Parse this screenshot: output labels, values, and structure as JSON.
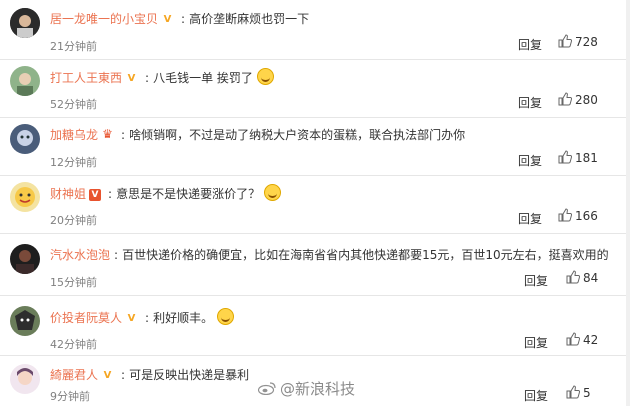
{
  "comments": [
    {
      "user": "居一龙唯一的小宝贝",
      "badge": "V",
      "text": "高价垄断麻烦也罚一下",
      "time": "21分钟前",
      "reply": "回复",
      "likes": "728"
    },
    {
      "user": "打工人王東西",
      "badge": "V",
      "text": "八毛钱一单 挨罚了",
      "time": "52分钟前",
      "reply": "回复",
      "likes": "280"
    },
    {
      "user": "加糖乌龙",
      "badge": "♛",
      "text": "啥倾销啊，不过是动了纳税大户资本的蛋糕，联合执法部门办你",
      "time": "12分钟前",
      "reply": "回复",
      "likes": "181"
    },
    {
      "user": "财神姐",
      "badge": "V",
      "text": "意思是不是快递要涨价了？",
      "time": "20分钟前",
      "reply": "回复",
      "likes": "166"
    },
    {
      "user": "汽水水泡泡",
      "badge": "",
      "text": "百世快递价格的确便宜，比如在海南省省内其他快递都要15元，百世10元左右，挺喜欢用的",
      "time": "15分钟前",
      "reply": "回复",
      "likes": "84"
    },
    {
      "user": "价投者阮莫人",
      "badge": "V",
      "text": "利好顺丰。",
      "time": "42分钟前",
      "reply": "回复",
      "likes": "42"
    },
    {
      "user": "綺麗君人",
      "badge": "V",
      "text": "可是反映出快递是暴利",
      "time": "9分钟前",
      "reply": "回复",
      "likes": "5"
    }
  ],
  "watermark": "@新浪科技",
  "colors": {
    "username": "#eb7350",
    "meta": "#808080",
    "badge_gold": "#f5a623",
    "badge_red": "#e8532e"
  },
  "icons": {
    "thumb": "thumbs-up-icon",
    "weibo": "weibo-logo-icon"
  }
}
